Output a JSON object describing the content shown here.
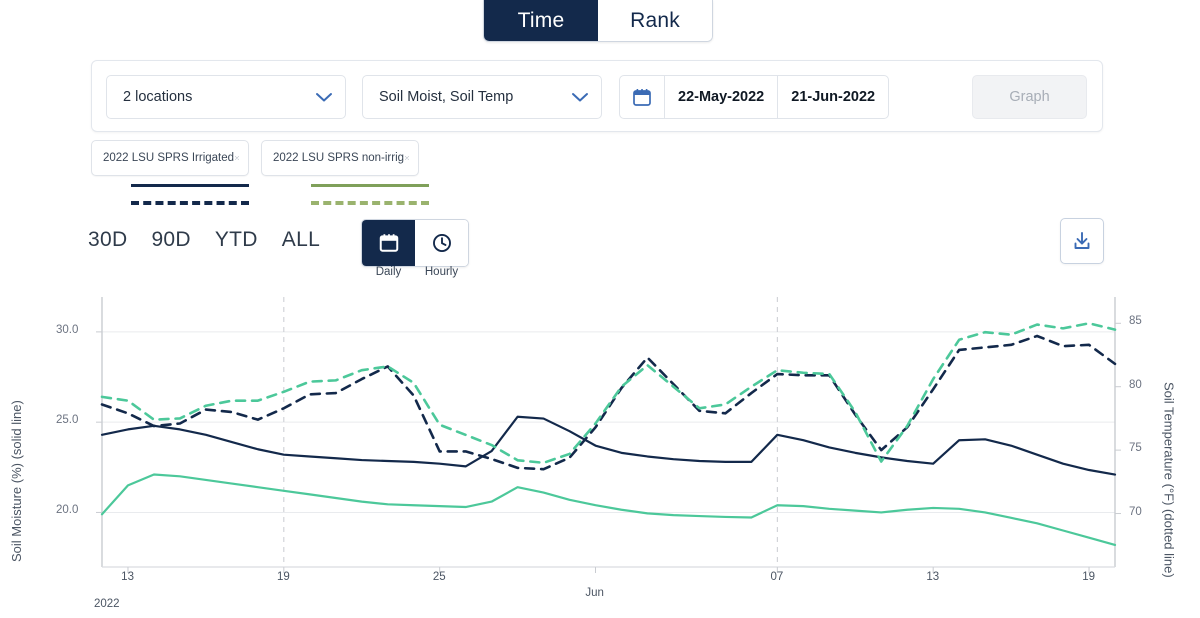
{
  "top_toggle": {
    "options": [
      {
        "label": "Time",
        "active": true
      },
      {
        "label": "Rank",
        "active": false
      }
    ]
  },
  "controls": {
    "locations_select": {
      "value": "2 locations",
      "icon": "chevron-down-icon"
    },
    "metrics_select": {
      "value": "Soil Moist, Soil Temp",
      "icon": "chevron-down-icon"
    },
    "date_range": {
      "icon": "calendar-icon",
      "start": "22-May-2022",
      "end": "21-Jun-2022"
    },
    "graph_button": {
      "label": "Graph",
      "disabled": true
    }
  },
  "location_chips": [
    {
      "label": "2022 LSU SPRS Irrigated",
      "color": "#13294b",
      "close_icon": "close-icon"
    },
    {
      "label": "2022 LSU SPRS non-irrig",
      "color": "#7fa05a",
      "close_icon": "close-icon"
    }
  ],
  "legend": [
    {
      "solid_color": "#13294b",
      "dashed_color": "#13294b"
    },
    {
      "solid_color": "#7fa05a",
      "dashed_color": "#9ab36e"
    }
  ],
  "range_buttons": [
    {
      "label": "30D"
    },
    {
      "label": "90D"
    },
    {
      "label": "YTD"
    },
    {
      "label": "ALL"
    }
  ],
  "frequency_toggle": {
    "options": [
      {
        "label": "Daily",
        "icon": "calendar-icon",
        "active": true
      },
      {
        "label": "Hourly",
        "icon": "clock-icon",
        "active": false
      }
    ]
  },
  "download_button": {
    "icon": "download-icon"
  },
  "colors": {
    "navy": "#13294b",
    "green": "#4cc89a",
    "accent_blue": "#3b6bb5",
    "grid": "#e6e8ec",
    "muted_text": "#6b7280"
  },
  "chart_data": {
    "type": "line",
    "title": "",
    "xlabel": "2022",
    "ylabel": "Soil Moisture (%) (solid line)",
    "y2label": "Soil Temperature (°F) (dotted line)",
    "grid": true,
    "legend_position": "top-left",
    "x_tick_labels": [
      "13",
      "19",
      "25",
      "Jun",
      "07",
      "13",
      "19"
    ],
    "x_tick_positions": [
      13,
      19,
      25,
      31,
      38,
      44,
      50
    ],
    "year_label": "2022",
    "yticks_left": [
      20.0,
      25.0,
      30.0
    ],
    "yticks_right": [
      70,
      75,
      80,
      85
    ],
    "ylim_left": [
      17.2,
      31.6
    ],
    "ylim_right": [
      66.1,
      86.6
    ],
    "x": [
      12,
      13,
      14,
      15,
      16,
      17,
      18,
      19,
      20,
      21,
      22,
      23,
      24,
      25,
      26,
      27,
      28,
      29,
      30,
      31,
      32,
      33,
      34,
      35,
      36,
      37,
      38,
      39,
      40,
      41,
      42,
      43,
      44,
      45,
      46,
      47,
      48,
      49,
      50,
      51
    ],
    "series": [
      {
        "name": "2022 LSU SPRS Irrigated – Soil Moisture (%)",
        "axis": "left",
        "style": "solid",
        "color": "#13294b",
        "values": [
          24.3,
          24.6,
          24.8,
          24.6,
          24.3,
          23.9,
          23.5,
          23.2,
          23.1,
          23.0,
          22.9,
          22.85,
          22.8,
          22.7,
          22.55,
          23.4,
          25.3,
          25.2,
          24.5,
          23.7,
          23.3,
          23.1,
          22.95,
          22.85,
          22.8,
          22.8,
          24.3,
          24.0,
          23.6,
          23.3,
          23.05,
          22.85,
          22.7,
          24.0,
          24.05,
          23.7,
          23.2,
          22.7,
          22.35,
          22.1
        ]
      },
      {
        "name": "2022 LSU SPRS Irrigated – Soil Temperature (°F)",
        "axis": "right",
        "style": "dashed",
        "color": "#13294b",
        "values": [
          78.6,
          77.9,
          76.9,
          77.1,
          78.2,
          78.0,
          77.4,
          78.3,
          79.4,
          79.5,
          80.6,
          81.6,
          79.3,
          74.9,
          74.9,
          74.3,
          73.6,
          73.5,
          74.4,
          76.8,
          79.9,
          82.3,
          80.2,
          78.1,
          77.9,
          79.5,
          81.0,
          80.9,
          80.9,
          77.8,
          75.0,
          76.8,
          79.8,
          82.9,
          83.1,
          83.3,
          84.0,
          83.2,
          83.3,
          81.8
        ]
      },
      {
        "name": "2022 LSU SPRS non-irrig – Soil Moisture (%)",
        "axis": "left",
        "style": "solid",
        "color": "#4cc89a",
        "values": [
          19.9,
          21.5,
          22.1,
          22.0,
          21.8,
          21.6,
          21.4,
          21.2,
          21.0,
          20.8,
          20.6,
          20.45,
          20.4,
          20.35,
          20.3,
          20.6,
          21.4,
          21.1,
          20.7,
          20.4,
          20.15,
          19.95,
          19.85,
          19.8,
          19.75,
          19.72,
          20.4,
          20.35,
          20.2,
          20.1,
          20.0,
          20.15,
          20.25,
          20.2,
          20.0,
          19.7,
          19.4,
          19.0,
          18.6,
          18.2
        ]
      },
      {
        "name": "2022 LSU SPRS non-irrig – Soil Temperature (°F)",
        "axis": "right",
        "style": "dashed",
        "color": "#4cc89a",
        "values": [
          79.2,
          78.9,
          77.4,
          77.5,
          78.5,
          78.9,
          78.9,
          79.6,
          80.4,
          80.5,
          81.3,
          81.6,
          80.3,
          77.0,
          76.2,
          75.4,
          74.2,
          74.0,
          74.7,
          77.1,
          80.0,
          81.7,
          80.0,
          78.3,
          78.6,
          80.0,
          81.3,
          81.1,
          81.0,
          78.0,
          74.1,
          76.9,
          80.6,
          83.7,
          84.3,
          84.1,
          84.9,
          84.6,
          85.0,
          84.5
        ]
      }
    ]
  }
}
